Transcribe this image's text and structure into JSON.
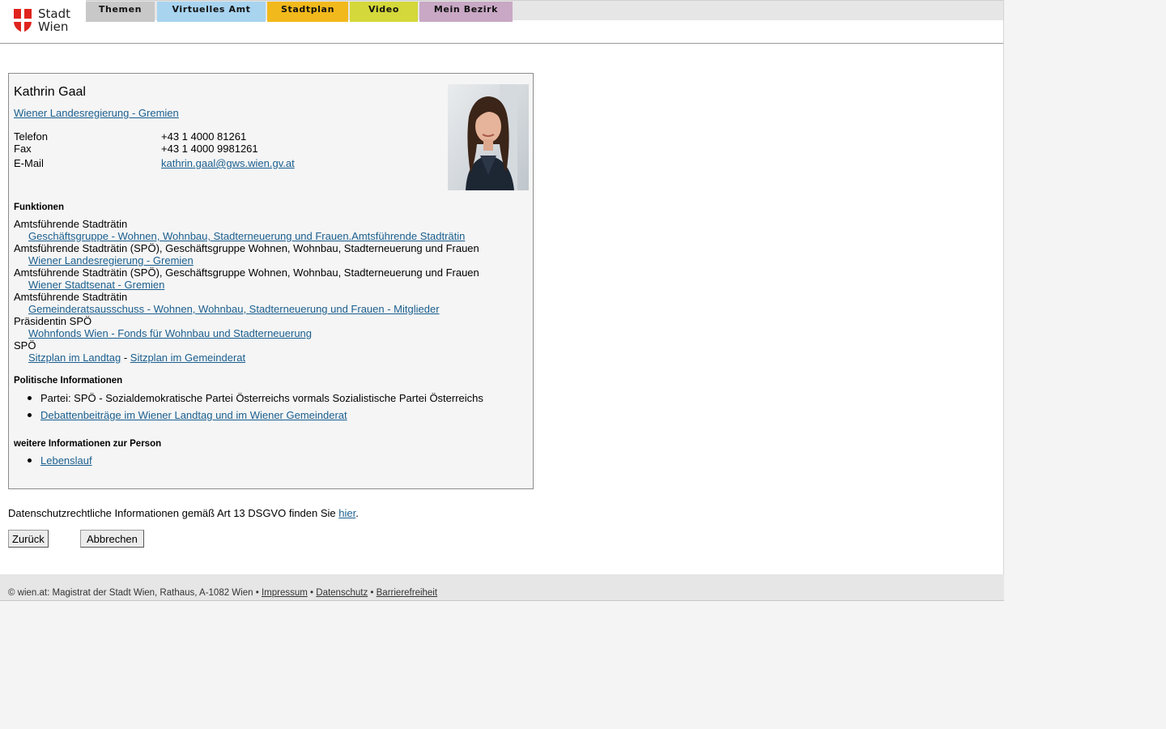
{
  "header": {
    "logo_line1": "Stadt",
    "logo_line2": "Wien",
    "nav": [
      {
        "label": "Themen",
        "color": "#c8c8c8"
      },
      {
        "label": "Virtuelles Amt",
        "color": "#a8d4f0"
      },
      {
        "label": "Stadtplan",
        "color": "#f2b91c"
      },
      {
        "label": "Video",
        "color": "#d4d83a"
      },
      {
        "label": "Mein Bezirk",
        "color": "#c8a8c4"
      }
    ]
  },
  "person": {
    "name": "Kathrin Gaal",
    "group_link": "Wiener Landesregierung - Gremien",
    "contacts": [
      {
        "label": "Telefon",
        "value": "+43 1 4000 81261"
      },
      {
        "label": "Fax",
        "value": "+43 1 4000 9981261"
      },
      {
        "label": "E-Mail",
        "value": "kathrin.gaal@gws.wien.gv.at"
      }
    ]
  },
  "functions": {
    "heading": "Funktionen",
    "items": [
      {
        "role": "Amtsführende Stadträtin",
        "link": "Geschäftsgruppe - Wohnen, Wohnbau, Stadterneuerung und Frauen.Amtsführende Stadträtin"
      },
      {
        "role": "Amtsführende Stadträtin (SPÖ), Geschäftsgruppe Wohnen, Wohnbau, Stadterneuerung und Frauen",
        "link": "Wiener Landesregierung - Gremien"
      },
      {
        "role": "Amtsführende Stadträtin (SPÖ), Geschäftsgruppe Wohnen, Wohnbau, Stadterneuerung und Frauen",
        "link": "Wiener Stadtsenat - Gremien"
      },
      {
        "role": "Amtsführende Stadträtin",
        "link": "Gemeinderatsausschuss - Wohnen, Wohnbau, Stadterneuerung und Frauen - Mitglieder"
      },
      {
        "role": "Präsidentin SPÖ",
        "link": "Wohnfonds Wien - Fonds für Wohnbau und Stadterneuerung"
      }
    ],
    "last_role": "SPÖ",
    "sitzplan_landtag": "Sitzplan im Landtag",
    "sitzplan_separator": "-",
    "sitzplan_gemeinderat": "Sitzplan im Gemeinderat"
  },
  "political": {
    "heading": "Politische Informationen",
    "party": "Partei: SPÖ - Sozialdemokratische Partei Österreichs vormals Sozialistische Partei Österreichs",
    "debates_link": "Debattenbeiträge im Wiener Landtag und im Wiener Gemeinderat"
  },
  "further": {
    "heading": "weitere Informationen zur Person",
    "cv_link": "Lebenslauf"
  },
  "privacy": {
    "text": "Datenschutzrechtliche Informationen gemäß Art 13 DSGVO finden Sie",
    "link": "hier",
    "end": "."
  },
  "buttons": {
    "back": "Zurück",
    "cancel": "Abbrechen"
  },
  "footer": {
    "text": "© wien.at: Magistrat der Stadt Wien, Rathaus, A-1082 Wien",
    "sep": "•",
    "links": [
      "Impressum",
      "Datenschutz",
      "Barrierefreiheit"
    ]
  }
}
